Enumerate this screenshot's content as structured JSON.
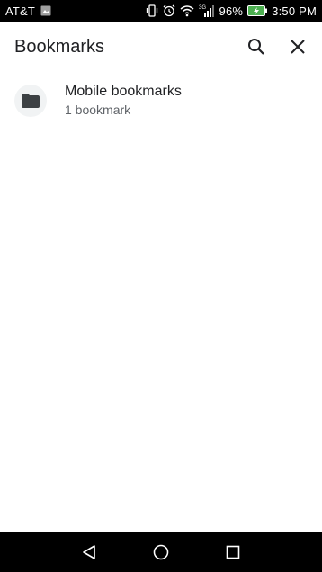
{
  "status_bar": {
    "carrier": "AT&T",
    "battery": "96%",
    "time": "3:50 PM",
    "network": "3G"
  },
  "app_bar": {
    "title": "Bookmarks"
  },
  "bookmarks": [
    {
      "title": "Mobile bookmarks",
      "subtitle": "1 bookmark"
    }
  ],
  "icons": {
    "search": "search-icon",
    "close": "close-icon",
    "folder": "folder-icon",
    "back": "back-icon",
    "home": "home-icon",
    "recents": "recents-icon"
  },
  "colors": {
    "text_primary": "#202124",
    "text_secondary": "#5f6368",
    "folder_bg": "#f1f3f4",
    "battery": "#4caf50"
  }
}
